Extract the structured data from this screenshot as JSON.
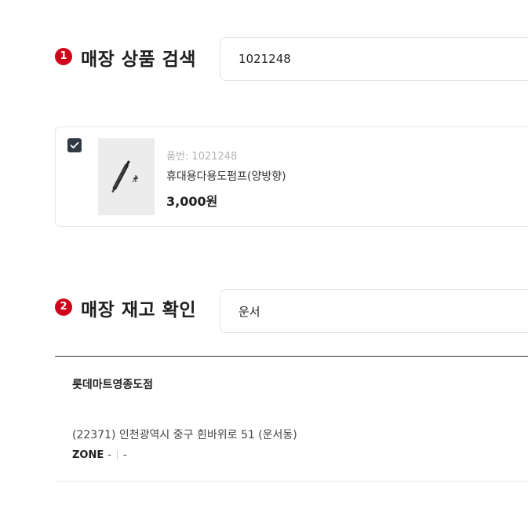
{
  "search_section": {
    "number": "1",
    "title": "매장 상품 검색",
    "input_value": "1021248"
  },
  "product": {
    "checked": true,
    "code_text": "품번: 1021248",
    "name": "휴대용다용도펌프(양방향)",
    "price": "3,000원",
    "image_icon": "portable-pump-icon"
  },
  "stock_section": {
    "number": "2",
    "title": "매장 재고 확인",
    "input_value": "운서"
  },
  "store": {
    "name": "롯데마트영종도점",
    "address": "(22371) 인천광역시 중구 흰바위로 51 (운서동)",
    "zone_label": "ZONE",
    "zone_value_1": "-",
    "zone_value_2": "-"
  },
  "colors": {
    "accent": "#d0021b",
    "checkbox": "#2f3a45"
  }
}
